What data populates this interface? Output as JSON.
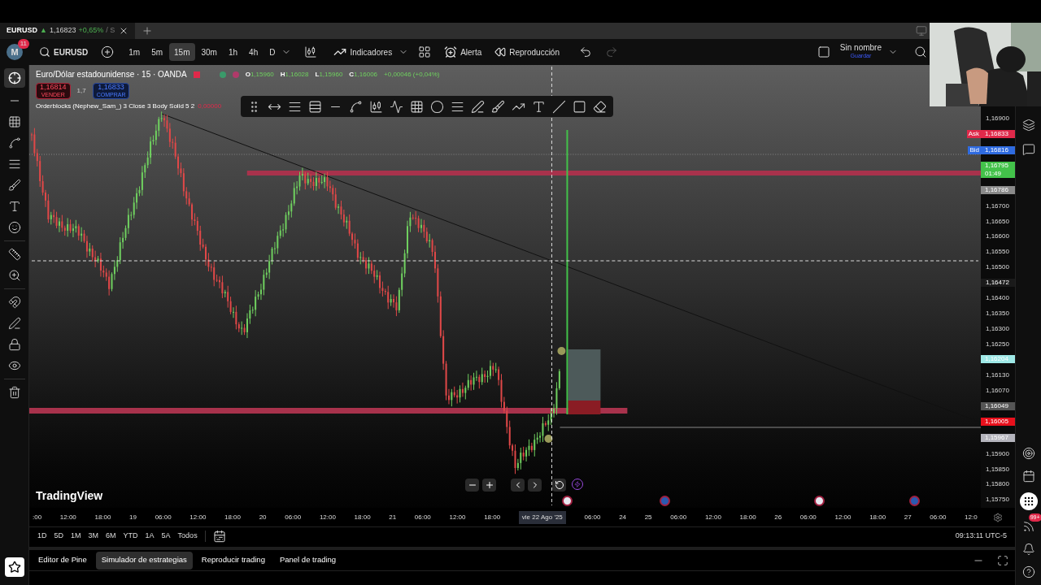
{
  "tab": {
    "symbol": "EURUSD",
    "arrow": "▲",
    "price": "1,16823",
    "change": "+0,65%",
    "trail": "/ S"
  },
  "toolbar": {
    "avatar": "M",
    "badge": "11",
    "search": "EURUSD",
    "intervals": [
      {
        "label": "1m",
        "selected": false
      },
      {
        "label": "5m",
        "selected": false
      },
      {
        "label": "15m",
        "selected": true
      },
      {
        "label": "30m",
        "selected": false
      },
      {
        "label": "1h",
        "selected": false
      },
      {
        "label": "4h",
        "selected": false
      },
      {
        "label": "D",
        "selected": false
      }
    ],
    "indicators": "Indicadores",
    "alert": "Alerta",
    "replay": "Reproducción",
    "layout_name": "Sin nombre",
    "save": "Guardar"
  },
  "legend": {
    "title": "Euro/Dólar estadounidense · 15 · OANDA",
    "ohlc": [
      {
        "label": "O",
        "value": "1,15960"
      },
      {
        "label": "H",
        "value": "1,16028"
      },
      {
        "label": "L",
        "value": "1,15960"
      },
      {
        "label": "C",
        "value": "1,16006"
      }
    ],
    "change": "+0,00046 (+0,04%)",
    "sell_price": "1,16814",
    "sell": "VENDER",
    "spread": "1,7",
    "buy_price": "1,16833",
    "buy": "COMPRAR",
    "indicator": "Orderblocks (Nephew_Sam_) 3 Close 3 Body Solid 5 2",
    "indicator_value": "0,00000"
  },
  "price_axis": [
    {
      "kind": "tick",
      "text": "1,16900"
    },
    {
      "kind": "tag",
      "prefix": "Ask",
      "text": "1,16833",
      "color": "#e0294a"
    },
    {
      "kind": "tag",
      "prefix": "Bid",
      "text": "1,16816",
      "color": "#2f6be0"
    },
    {
      "kind": "tag",
      "text": "1,16795",
      "sub": "01:49",
      "color": "#43c24a"
    },
    {
      "kind": "tag",
      "text": "1,16786",
      "color": "#8a8a8a"
    },
    {
      "kind": "tick",
      "text": "1,16700"
    },
    {
      "kind": "tick",
      "text": "1,16650"
    },
    {
      "kind": "tick",
      "text": "1,16600"
    },
    {
      "kind": "tick",
      "text": "1,16550"
    },
    {
      "kind": "tick",
      "text": "1,16500"
    },
    {
      "kind": "cursor",
      "text": "1,16472"
    },
    {
      "kind": "tick",
      "text": "1,16400"
    },
    {
      "kind": "tick",
      "text": "1,16350"
    },
    {
      "kind": "tick",
      "text": "1,16300"
    },
    {
      "kind": "tick",
      "text": "1,16250"
    },
    {
      "kind": "tag",
      "text": "1,16204",
      "color": "#9ee8e6"
    },
    {
      "kind": "tick",
      "text": "1,16130"
    },
    {
      "kind": "tick",
      "text": "1,16070"
    },
    {
      "kind": "tag",
      "text": "1,16049",
      "color": "#555555"
    },
    {
      "kind": "tag",
      "text": "1,16005",
      "color": "#e8101c"
    },
    {
      "kind": "tag",
      "text": "1,15967",
      "color": "#b4b4bc"
    },
    {
      "kind": "tick",
      "text": "1,15900"
    },
    {
      "kind": "tick",
      "text": "1,15850"
    },
    {
      "kind": "tick",
      "text": "1,15800"
    },
    {
      "kind": "tick",
      "text": "1,15750"
    }
  ],
  "watermark": "TradingView",
  "events": [
    {
      "kind": "us"
    },
    {
      "kind": "eu"
    },
    {
      "kind": "us"
    },
    {
      "kind": "eu"
    }
  ],
  "time_axis": [
    {
      "kind": "tick",
      "text": ":00"
    },
    {
      "kind": "tick",
      "text": "12:00"
    },
    {
      "kind": "tick",
      "text": "18:00"
    },
    {
      "kind": "tick",
      "text": "19"
    },
    {
      "kind": "tick",
      "text": "06:00"
    },
    {
      "kind": "tick",
      "text": "12:00"
    },
    {
      "kind": "tick",
      "text": "18:00"
    },
    {
      "kind": "tick",
      "text": "20"
    },
    {
      "kind": "tick",
      "text": "06:00"
    },
    {
      "kind": "tick",
      "text": "12:00"
    },
    {
      "kind": "tick",
      "text": "18:00"
    },
    {
      "kind": "tick",
      "text": "21"
    },
    {
      "kind": "tick",
      "text": "06:00"
    },
    {
      "kind": "tick",
      "text": "12:00"
    },
    {
      "kind": "tick",
      "text": "18:00"
    },
    {
      "kind": "cursor",
      "text": "vie 22 Ago '25"
    },
    {
      "kind": "tick",
      "text": "06:00"
    },
    {
      "kind": "tick",
      "text": "24"
    },
    {
      "kind": "tick",
      "text": "25"
    },
    {
      "kind": "tick",
      "text": "06:00"
    },
    {
      "kind": "tick",
      "text": "12:00"
    },
    {
      "kind": "tick",
      "text": "18:00"
    },
    {
      "kind": "tick",
      "text": "26"
    },
    {
      "kind": "tick",
      "text": "06:00"
    },
    {
      "kind": "tick",
      "text": "12:00"
    },
    {
      "kind": "tick",
      "text": "18:00"
    },
    {
      "kind": "tick",
      "text": "27"
    },
    {
      "kind": "tick",
      "text": "06:00"
    },
    {
      "kind": "tick",
      "text": "12:0"
    }
  ],
  "ranges": [
    "1D",
    "5D",
    "1M",
    "3M",
    "6M",
    "YTD",
    "1A",
    "5A",
    "Todos"
  ],
  "clock": "09:13:11 UTC-5",
  "bottom_tabs": [
    {
      "label": "Editor de Pine",
      "selected": false
    },
    {
      "label": "Simulador de estrategias",
      "selected": true
    },
    {
      "label": "Reproducir trading",
      "selected": false
    },
    {
      "label": "Panel de trading",
      "selected": false
    }
  ],
  "feed_badge": "99+"
}
